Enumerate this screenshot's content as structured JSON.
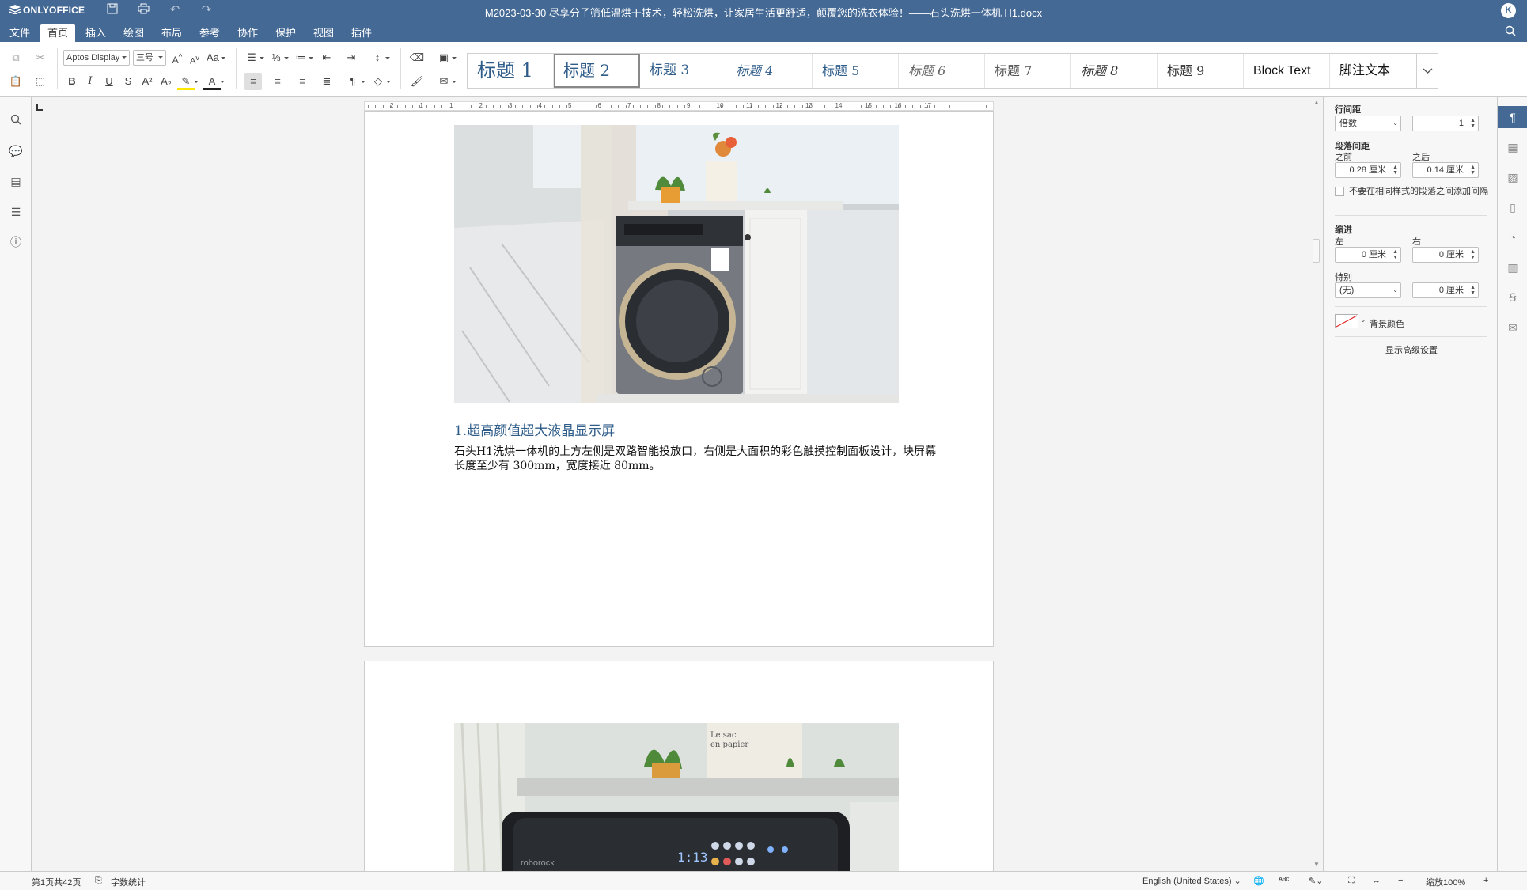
{
  "app": {
    "name": "ONLYOFFICE",
    "accent": "#446995"
  },
  "titlebar": {
    "document_title": "M2023-03-30 尽享分子筛低温烘干技术，轻松洗烘，让家居生活更舒适，颠覆您的洗衣体验！——石头洗烘一体机 H1.docx",
    "user_initial": "K"
  },
  "menu": {
    "tabs": [
      "文件",
      "首页",
      "插入",
      "绘图",
      "布局",
      "参考",
      "协作",
      "保护",
      "视图",
      "插件"
    ],
    "active": "首页"
  },
  "toolbar": {
    "font_name": "Aptos Display",
    "font_size": "三号",
    "change_case": "Aa",
    "grow_font": "A",
    "shrink_font": "A"
  },
  "styles": [
    "标题 1",
    "标题 2",
    "标题 3",
    "标题 4",
    "标题 5",
    "标题 6",
    "标题 7",
    "标题 8",
    "标题 9",
    "Block Text",
    "脚注文本"
  ],
  "ruler": {
    "numbers": [
      "2",
      "1",
      "1",
      "2",
      "3",
      "4",
      "5",
      "6",
      "7",
      "8",
      "9",
      "10",
      "11",
      "12",
      "13",
      "14",
      "15",
      "16",
      "17"
    ]
  },
  "document": {
    "heading": "1.超高颜值超大液晶显示屏",
    "body": "石头H1洗烘一体机的上方左侧是双路智能投放口，右侧是大面积的彩色触摸控制面板设计，块屏幕长度至少有 300mm，宽度接近 80mm。",
    "photo2_brand": "roborock",
    "photo2_display": "1:13",
    "photo2_card": "Le sac en papier"
  },
  "right_panel": {
    "line_spacing_label": "行间距",
    "line_spacing_type": "倍数",
    "line_spacing_value": "1",
    "para_spacing_label": "段落间距",
    "before_label": "之前",
    "before_value": "0.28 厘米",
    "after_label": "之后",
    "after_value": "0.14 厘米",
    "no_space_checkbox": "不要在相同样式的段落之间添加间隔",
    "indent_label": "缩进",
    "left_label": "左",
    "left_value": "0 厘米",
    "right_label": "右",
    "right_value": "0 厘米",
    "special_label": "特别",
    "special_value": "(无)",
    "special_amount": "0 厘米",
    "bg_color_label": "背景颜色",
    "advanced_link": "显示高级设置"
  },
  "statusbar": {
    "page_info": "第1页共42页",
    "word_count": "字数统计",
    "language": "English (United States)",
    "zoom": "缩放100%"
  }
}
